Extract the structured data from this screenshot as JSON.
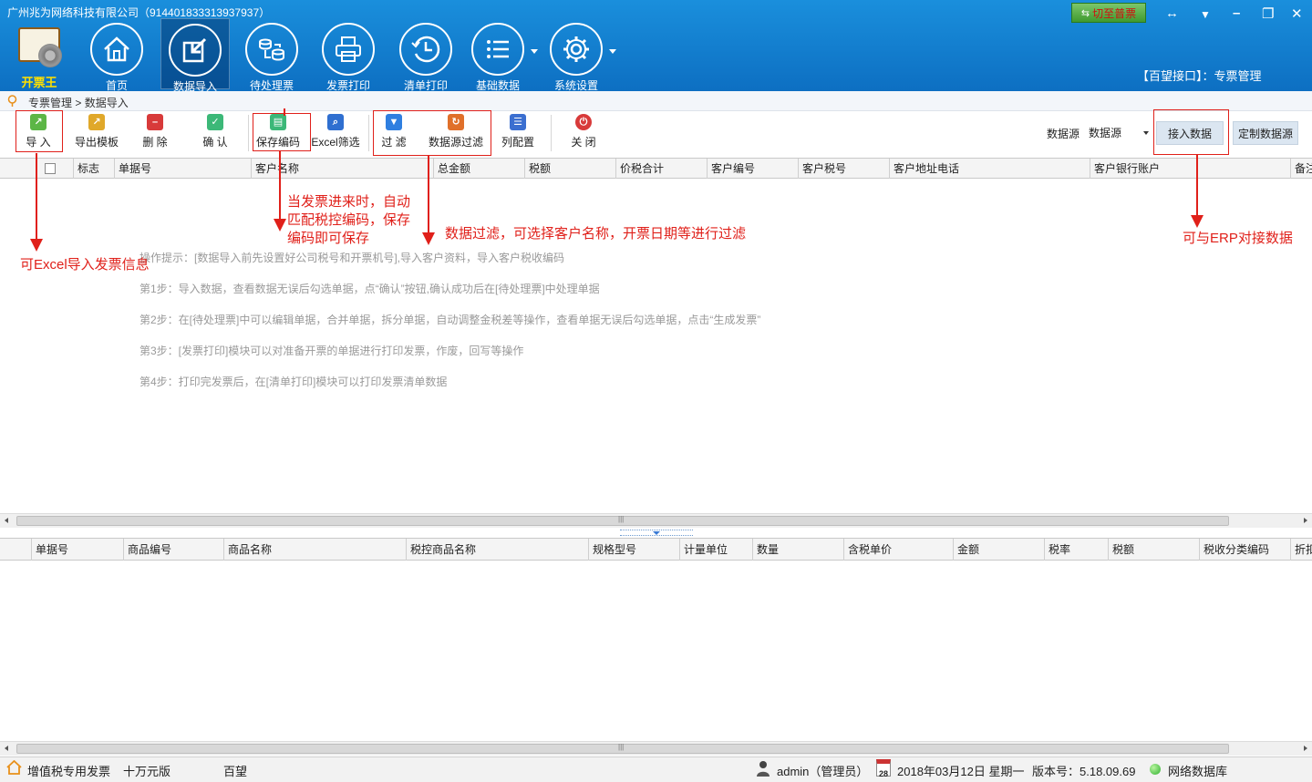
{
  "window": {
    "title": "广州兆为网络科技有限公司（914401833313937937）",
    "switch_label": "切至普票",
    "module_title": "【百望接口】：专票管理"
  },
  "logo": {
    "label": "开票王"
  },
  "nav": [
    {
      "label": "首页",
      "icon": "home-icon"
    },
    {
      "label": "数据导入",
      "icon": "import-icon",
      "active": true
    },
    {
      "label": "待处理票",
      "icon": "pending-icon"
    },
    {
      "label": "发票打印",
      "icon": "printer-icon"
    },
    {
      "label": "清单打印",
      "icon": "clock-icon"
    },
    {
      "label": "基础数据",
      "icon": "list-icon"
    },
    {
      "label": "系统设置",
      "icon": "gear-icon"
    }
  ],
  "breadcrumb": {
    "parent": "专票管理",
    "separator": ">",
    "current": "数据导入"
  },
  "toolbar": {
    "import": "导 入",
    "export_template": "导出模板",
    "delete": "删 除",
    "confirm": "确 认",
    "save_code": "保存编码",
    "excel_filter": "Excel筛选",
    "filter": "过 滤",
    "datasource_filter": "数据源过滤",
    "column_config": "列配置",
    "close": "关 闭",
    "datasource_label": "数据源",
    "datasource_value": "数据源",
    "connect": "接入数据",
    "custom_datasource": "定制数据源"
  },
  "grid1": {
    "columns": [
      "标志",
      "单据号",
      "客户名称",
      "总金额",
      "税额",
      "价税合计",
      "客户编号",
      "客户税号",
      "客户地址电话",
      "客户银行账户",
      "备注"
    ]
  },
  "tips": [
    "操作提示：[数据导入前先设置好公司税号和开票机号],导入客户资料，导入客户税收编码",
    "第1步：导入数据，查看数据无误后勾选单据，点“确认”按钮,确认成功后在[待处理票]中处理单据",
    "第2步：在[待处理票]中可以编辑单据，合并单据，拆分单据，自动调整金税差等操作，查看单据无误后勾选单据，点击“生成发票”",
    "第3步：[发票打印]模块可以对准备开票的单据进行打印发票，作废，回写等操作",
    "第4步：打印完发票后，在[清单打印]模块可以打印发票清单数据"
  ],
  "annotations": {
    "import": "可Excel导入发票信息",
    "save_code": [
      "当发票进来时，自动",
      "匹配税控编码，保存",
      "编码即可保存"
    ],
    "filter": "数据过滤，可选择客户名称，开票日期等进行过滤",
    "erp": "可与ERP对接数据"
  },
  "grid2": {
    "columns": [
      "单据号",
      "商品编号",
      "商品名称",
      "税控商品名称",
      "规格型号",
      "计量单位",
      "数量",
      "含税单价",
      "金额",
      "税率",
      "税额",
      "税收分类编码",
      "折扣"
    ]
  },
  "status": {
    "invoice_type": "增值税专用发票",
    "limit": "十万元版",
    "provider": "百望",
    "user": "admin（管理员）",
    "calendar_day": "28",
    "date": "2018年03月12日 星期一",
    "version": "版本号：5.18.09.69",
    "database": "网络数据库"
  },
  "colors": {
    "header": "#1a8fdc",
    "annotation": "#e0201a",
    "logo_text": "#ffe000"
  }
}
